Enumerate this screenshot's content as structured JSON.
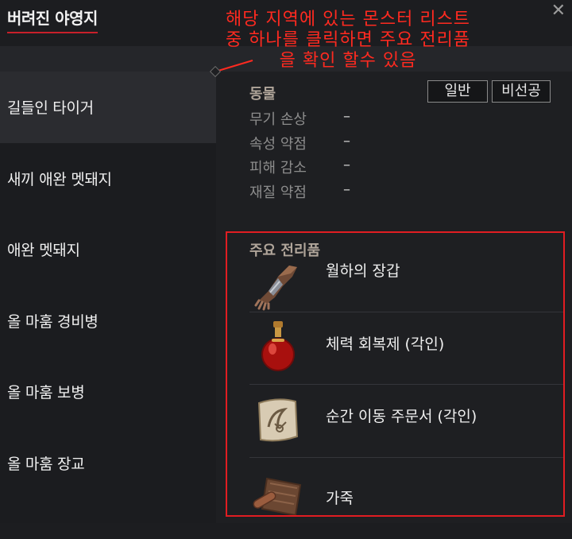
{
  "window": {
    "title": "버려진 야영지",
    "close_glyph": "✕"
  },
  "annotation": {
    "line1": "해당 지역에 있는 몬스터 리스트",
    "line2": "중 하나를 클릭하면 주요 전리품",
    "line3": "을 확인 할수 있음",
    "color": "#ff2a20"
  },
  "sidebar": {
    "items": [
      {
        "label": "길들인 타이거",
        "active": true
      },
      {
        "label": "새끼 애완 멧돼지",
        "active": false
      },
      {
        "label": "애완 멧돼지",
        "active": false
      },
      {
        "label": "올 마훔 경비병",
        "active": false
      },
      {
        "label": "올 마훔 보병",
        "active": false
      },
      {
        "label": "올 마훔 장교",
        "active": false
      }
    ]
  },
  "detail": {
    "category": "동물",
    "buttons": {
      "normal": "일반",
      "non_aggressive": "비선공"
    },
    "stats": [
      {
        "label": "무기 손상",
        "value": "–"
      },
      {
        "label": "속성 약점",
        "value": "–"
      },
      {
        "label": "피해 감소",
        "value": "–"
      },
      {
        "label": "재질 약점",
        "value": "–"
      }
    ],
    "loot_title": "주요 전리품",
    "loot": [
      {
        "name": "월하의 장갑",
        "icon": "gauntlet-icon"
      },
      {
        "name": "체력 회복제 (각인)",
        "icon": "red-potion-icon"
      },
      {
        "name": "순간 이동 주문서 (각인)",
        "icon": "teleport-scroll-icon"
      },
      {
        "name": "가죽",
        "icon": "leather-icon"
      }
    ]
  },
  "colors": {
    "highlight_border": "#e11d22",
    "title_underline": "#c8202a",
    "category_text": "#b0a59a"
  }
}
